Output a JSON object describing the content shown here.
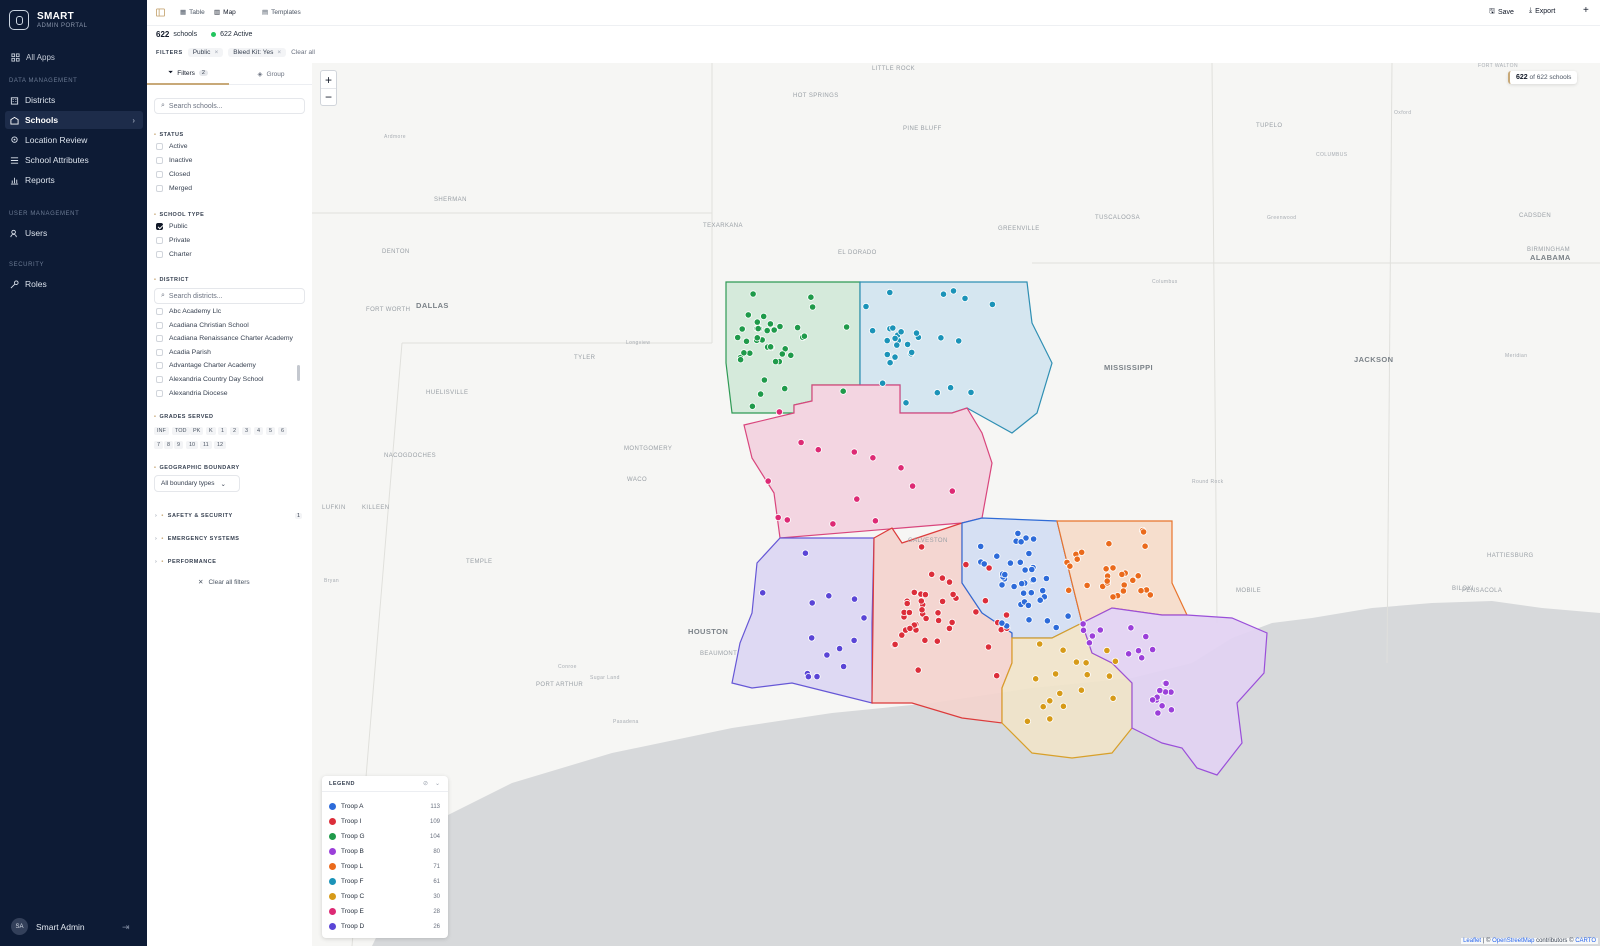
{
  "brand": {
    "name": "SMART",
    "subtitle": "ADMIN PORTAL"
  },
  "sidebar": {
    "all_apps": "All Apps",
    "sections": [
      {
        "title": "DATA MANAGEMENT",
        "items": [
          {
            "label": "Districts",
            "icon": "building-icon"
          },
          {
            "label": "Schools",
            "icon": "school-icon",
            "active": true
          },
          {
            "label": "Location Review",
            "icon": "pin-icon"
          },
          {
            "label": "School Attributes",
            "icon": "list-icon"
          },
          {
            "label": "Reports",
            "icon": "chart-icon"
          }
        ]
      },
      {
        "title": "USER MANAGEMENT",
        "items": [
          {
            "label": "Users",
            "icon": "users-icon"
          }
        ]
      },
      {
        "title": "SECURITY",
        "items": [
          {
            "label": "Roles",
            "icon": "key-icon"
          }
        ]
      }
    ],
    "user": {
      "initials": "SA",
      "name": "Smart Admin"
    }
  },
  "topbar": {
    "views": [
      {
        "label": "Table"
      },
      {
        "label": "Map",
        "active": true
      }
    ],
    "templates": "Templates",
    "save": "Save",
    "export": "Export"
  },
  "stats": {
    "count": "622",
    "count_label": "schools",
    "active": "622 Active"
  },
  "filter_bar": {
    "label": "FILTERS",
    "chips": [
      "Public",
      "Bleed Kit: Yes"
    ],
    "clear": "Clear all"
  },
  "panel": {
    "tabs": [
      {
        "label": "Filters",
        "badge": "2",
        "active": true
      },
      {
        "label": "Group"
      }
    ],
    "search_placeholder": "Search schools...",
    "status": {
      "title": "STATUS",
      "options": [
        {
          "label": "Active",
          "checked": false
        },
        {
          "label": "Inactive",
          "checked": false
        },
        {
          "label": "Closed",
          "checked": false
        },
        {
          "label": "Merged",
          "checked": false
        }
      ]
    },
    "school_type": {
      "title": "SCHOOL TYPE",
      "options": [
        {
          "label": "Public",
          "checked": true
        },
        {
          "label": "Private",
          "checked": false
        },
        {
          "label": "Charter",
          "checked": false
        }
      ]
    },
    "district": {
      "title": "DISTRICT",
      "search_placeholder": "Search districts...",
      "items": [
        "Abc Academy Llc",
        "Acadiana Christian School",
        "Acadiana Renaissance Charter Academy",
        "Acadia Parish",
        "Advantage Charter Academy",
        "Alexandria Country Day School",
        "Alexandria Diocese"
      ]
    },
    "grades": {
      "title": "GRADES SERVED",
      "values": [
        "INF",
        "TOD",
        "PK",
        "K",
        "1",
        "2",
        "3",
        "4",
        "5",
        "6",
        "7",
        "8",
        "9",
        "10",
        "11",
        "12"
      ]
    },
    "boundary": {
      "title": "GEOGRAPHIC BOUNDARY",
      "selected": "All boundary types"
    },
    "collapsed": [
      {
        "label": "SAFETY & SECURITY",
        "count": "1"
      },
      {
        "label": "EMERGENCY SYSTEMS"
      },
      {
        "label": "PERFORMANCE"
      }
    ],
    "clear_all": "Clear all filters"
  },
  "map": {
    "count_box": {
      "count": "622",
      "label": "of 622 schools"
    },
    "legend": {
      "title": "LEGEND",
      "items": [
        {
          "label": "Troop A",
          "count": "113",
          "color": "#2d6bd9"
        },
        {
          "label": "Troop I",
          "count": "109",
          "color": "#dc2e3a"
        },
        {
          "label": "Troop G",
          "count": "104",
          "color": "#1f9a4a"
        },
        {
          "label": "Troop B",
          "count": "80",
          "color": "#9b3fd9"
        },
        {
          "label": "Troop L",
          "count": "71",
          "color": "#ea6a1c"
        },
        {
          "label": "Troop F",
          "count": "61",
          "color": "#1b93b8"
        },
        {
          "label": "Troop C",
          "count": "30",
          "color": "#d69a18"
        },
        {
          "label": "Troop E",
          "count": "28",
          "color": "#dd2a74"
        },
        {
          "label": "Troop D",
          "count": "26",
          "color": "#5a45d6"
        }
      ]
    },
    "attribution": {
      "leaflet": "Leaflet",
      "sep": " | © ",
      "osm": "OpenStreetMap",
      "contrib": " contributors © ",
      "carto": "CARTO"
    },
    "cities": [
      "LITTLE ROCK",
      "HOT SPRINGS",
      "PINE BLUFF",
      "Ardmore",
      "SHERMAN",
      "TEXARKANA",
      "EL DORADO",
      "GREENVILLE",
      "DENTON",
      "DALLAS",
      "FORT WORTH",
      "TYLER",
      "Longview",
      "Oxford",
      "TUPELO",
      "COLUMBUS",
      "CADSDEN",
      "BIRMINGHAM",
      "ALABAMA",
      "TUSCALOOSA",
      "Greenwood",
      "Columbus",
      "MISSISSIPPI",
      "JACKSON",
      "Meridian",
      "MONTGOMERY",
      "NACOGDOCHES",
      "WACO",
      "LUFKIN",
      "KILLEEN",
      "TEMPLE",
      "Bryan",
      "Round Rock",
      "HATTIESBURG",
      "MOBILE",
      "BILOXI",
      "PENSACOLA",
      "FORT WALTON",
      "HUELISVILLE",
      "Conroe",
      "HOUSTON",
      "BEAUMONT",
      "PORT ARTHUR",
      "Sugar Land",
      "Pasadena",
      "GALVESTON",
      "LOUISIANA"
    ]
  }
}
